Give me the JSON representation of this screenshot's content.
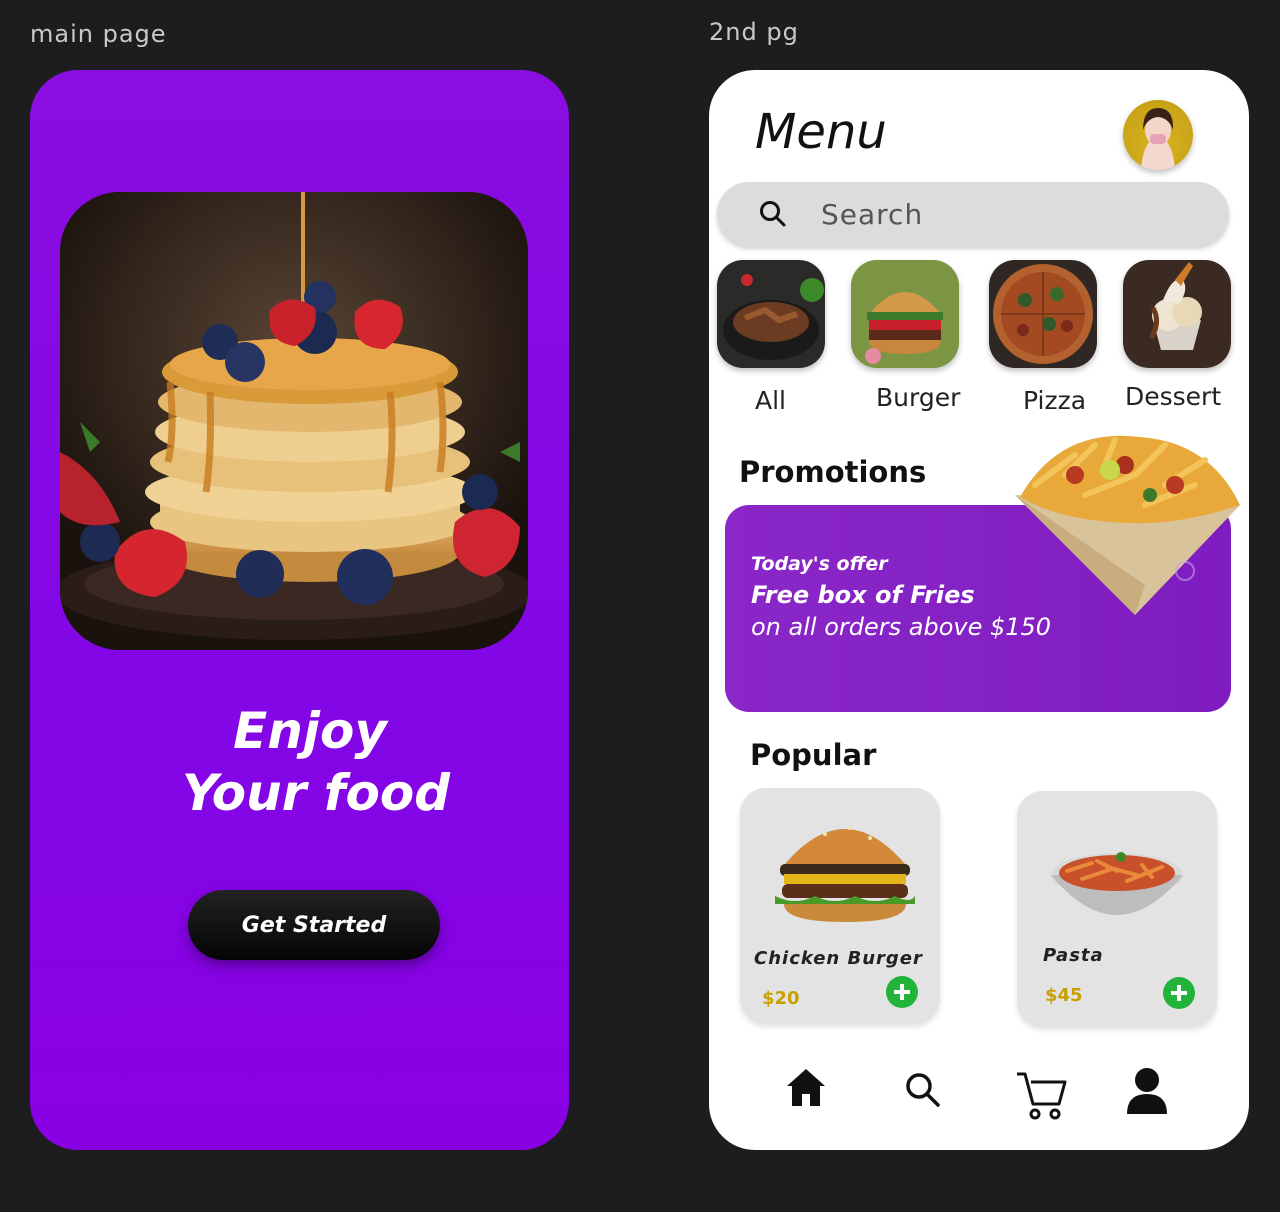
{
  "frames": {
    "main_label": "main page",
    "second_label": "2nd pg"
  },
  "main_page": {
    "hero_line1": "Enjoy",
    "hero_line2": "Your food",
    "cta_label": "Get Started",
    "background_color": "#8a06e4"
  },
  "menu_page": {
    "title": "Menu",
    "search": {
      "placeholder": "Search"
    },
    "categories": [
      {
        "label": "All"
      },
      {
        "label": "Burger"
      },
      {
        "label": "Pizza"
      },
      {
        "label": "Dessert"
      }
    ],
    "promotions": {
      "heading": "Promotions",
      "line1": "Today's offer",
      "line2": "Free box of Fries",
      "line3": "on all orders above $150"
    },
    "popular": {
      "heading": "Popular",
      "items": [
        {
          "name": "Chicken Burger",
          "price": "$20"
        },
        {
          "name": "Pasta",
          "price": "$45"
        }
      ]
    },
    "bottom_nav": [
      {
        "icon": "home-icon"
      },
      {
        "icon": "search-icon"
      },
      {
        "icon": "cart-icon"
      },
      {
        "icon": "profile-icon"
      }
    ],
    "accent_color": "#8a27c8",
    "add_button_color": "#22b33a",
    "price_color": "#c8a000"
  }
}
